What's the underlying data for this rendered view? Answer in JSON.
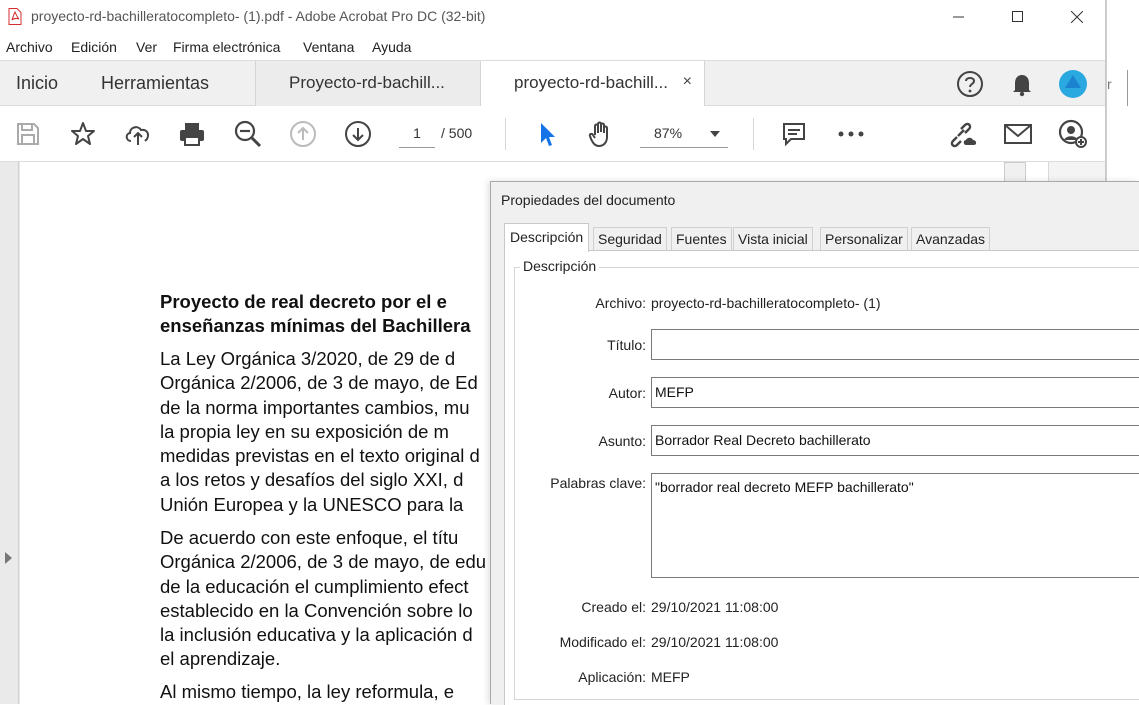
{
  "window": {
    "title": "proyecto-rd-bachilleratocompleto- (1).pdf - Adobe Acrobat Pro DC (32-bit)",
    "minimize_icon": "minimize-icon",
    "maximize_icon": "maximize-icon",
    "close_icon": "close-icon"
  },
  "menu": {
    "items": [
      "Archivo",
      "Edición",
      "Ver",
      "Firma electrónica",
      "Ventana",
      "Ayuda"
    ]
  },
  "tabs": {
    "home": "Inicio",
    "tools": "Herramientas",
    "doc1": "Proyecto-rd-bachill...",
    "doc2": "proyecto-rd-bachill...",
    "close_glyph": "×"
  },
  "toolbar": {
    "page_current": "1",
    "page_total": "/ 500",
    "zoom": "87%"
  },
  "document": {
    "heading": "Proyecto de real decreto por el e enseñanzas mínimas del Bachillera",
    "para1": [
      "La Ley Orgánica 3/2020, de 29 de d",
      "Orgánica 2/2006, de 3 de mayo, de Ed",
      "de la norma importantes cambios, mu",
      "la propia ley en su exposición de m",
      "medidas previstas en el texto original d",
      "a los retos y desafíos del siglo XXI, d",
      "Unión Europea y la UNESCO para la"
    ],
    "para2": [
      "De acuerdo con este enfoque, el títu",
      "Orgánica 2/2006, de 3 de mayo, de edu",
      "de la educación el cumplimiento efect",
      "establecido en la Convención sobre lo",
      "la inclusión educativa y la aplicación d",
      "el aprendizaje."
    ],
    "para3": "Al mismo tiempo, la ley reformula, e"
  },
  "dialog": {
    "title": "Propiedades del documento",
    "tabs": [
      "Descripción",
      "Seguridad",
      "Fuentes",
      "Vista inicial",
      "Personalizar",
      "Avanzadas"
    ],
    "group_label": "Descripción",
    "fields": {
      "archivo_label": "Archivo:",
      "archivo_value": "proyecto-rd-bachilleratocompleto- (1)",
      "titulo_label": "Título:",
      "titulo_value": "",
      "autor_label": "Autor:",
      "autor_value": "MEFP",
      "asunto_label": "Asunto:",
      "asunto_value": "Borrador Real Decreto bachillerato",
      "palabras_label": "Palabras clave:",
      "palabras_value": "\"borrador  real decreto  MEFP  bachillerato\"",
      "creado_label": "Creado el:",
      "creado_value": "29/10/2021 11:08:00",
      "modificado_label": "Modificado el:",
      "modificado_value": "29/10/2021 11:08:00",
      "aplicacion_label": "Aplicación:",
      "aplicacion_value": "MEFP"
    }
  },
  "background_window": {
    "fragment": "r"
  },
  "colors": {
    "accent_blue": "#1473e6",
    "acrobat_red": "#d32f2f",
    "avatar_cyan": "#2aa8e0"
  }
}
